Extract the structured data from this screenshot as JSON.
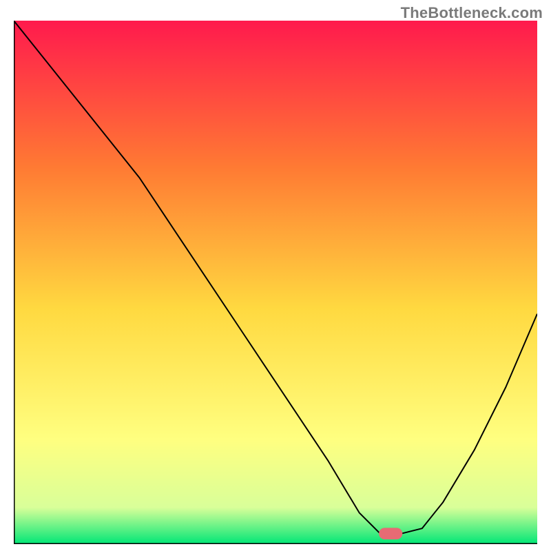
{
  "watermark": "TheBottleneck.com",
  "chart_data": {
    "type": "line",
    "title": "",
    "xlabel": "",
    "ylabel": "",
    "xlim": [
      0,
      100
    ],
    "ylim": [
      0,
      100
    ],
    "grid": false,
    "background_gradient": {
      "top_color": "#ff1a4d",
      "quarter_color": "#ff7a33",
      "mid_color": "#ffd940",
      "three_quarter_color": "#ffff80",
      "near_bottom_color": "#d9ff99",
      "bottom_color": "#00e676"
    },
    "curve_color": "#000000",
    "curve_width": 2,
    "series": [
      {
        "name": "bottleneck-curve",
        "x": [
          0,
          8,
          16,
          24,
          28,
          36,
          44,
          52,
          60,
          66,
          70,
          74,
          78,
          82,
          88,
          94,
          100
        ],
        "y": [
          100,
          90,
          80,
          70,
          64,
          52,
          40,
          28,
          16,
          6,
          2,
          2,
          3,
          8,
          18,
          30,
          44
        ]
      }
    ],
    "marker": {
      "name": "optimal-marker",
      "x": 72,
      "y": 2,
      "color": "#e76b74",
      "width_pct": 4.5,
      "height_pct": 2.2,
      "rx_pct": 1.1
    },
    "axes_color": "#000000",
    "axes_width": 3
  }
}
